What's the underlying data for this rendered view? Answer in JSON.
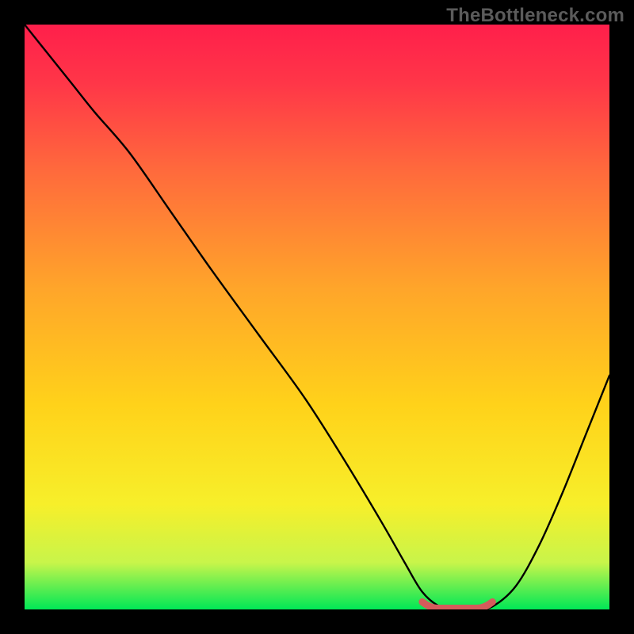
{
  "watermark": "TheBottleneck.com",
  "colors": {
    "bg": "#000000",
    "grad_top": "#ff1f4b",
    "grad_mid": "#ffde00",
    "grad_bot": "#00e756",
    "curve": "#000000",
    "trough_marker": "#d55b5b"
  },
  "chart_data": {
    "type": "line",
    "title": "",
    "xlabel": "",
    "ylabel": "",
    "xlim": [
      0,
      100
    ],
    "ylim": [
      0,
      100
    ],
    "series": [
      {
        "name": "bottleneck-curve",
        "x": [
          0,
          4,
          8,
          12,
          18,
          25,
          32,
          40,
          48,
          55,
          61,
          65,
          68,
          71,
          74,
          77,
          80,
          84,
          88,
          92,
          96,
          100
        ],
        "y": [
          100,
          95,
          90,
          85,
          78,
          68,
          58,
          47,
          36,
          25,
          15,
          8,
          3,
          0.5,
          0,
          0,
          0.5,
          4,
          11,
          20,
          30,
          40
        ]
      }
    ],
    "trough_marker": {
      "x_start": 68,
      "x_end": 80,
      "y": 0.2
    },
    "grid": false,
    "legend": false
  }
}
